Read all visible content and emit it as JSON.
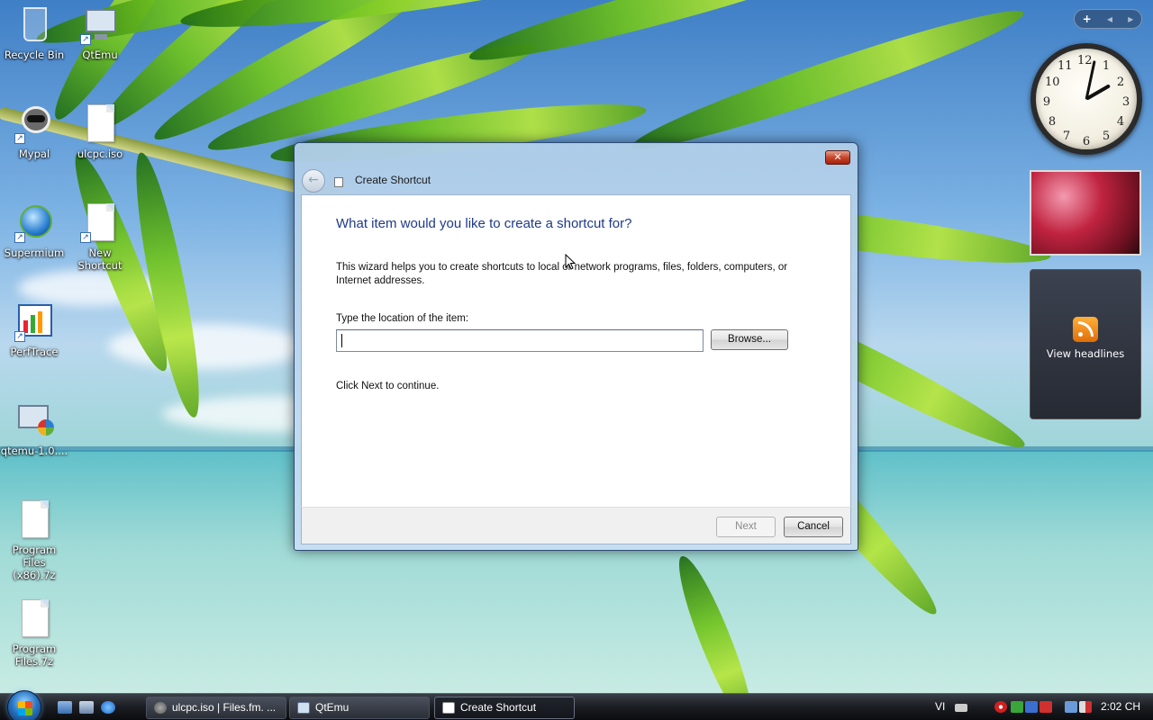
{
  "desktop": {
    "icons": [
      {
        "label": "Recycle Bin"
      },
      {
        "label": "QtEmu"
      },
      {
        "label": "Mypal"
      },
      {
        "label": "ulcpc.iso"
      },
      {
        "label": "Supermium"
      },
      {
        "label": "New Shortcut"
      },
      {
        "label": "PerfTrace"
      },
      {
        "label": "qtemu-1.0...."
      },
      {
        "label": "Program Files (x86).7z"
      },
      {
        "label": "Program Files.7z"
      }
    ]
  },
  "sidebar": {
    "add_label": "+",
    "clock": {
      "numbers": [
        "12",
        "1",
        "2",
        "3",
        "4",
        "5",
        "6",
        "7",
        "8",
        "9",
        "10",
        "11"
      ]
    },
    "feed": {
      "label": "View headlines"
    }
  },
  "dialog": {
    "title": "Create Shortcut",
    "close_label": "✕",
    "back_label": "←",
    "heading": "What item would you like to create a shortcut for?",
    "description": "This wizard helps you to create shortcuts to local or network programs, files, folders, computers, or Internet addresses.",
    "location_label": "Type the location of the item:",
    "location_value": "",
    "browse_label": "Browse...",
    "continue_text": "Click Next to continue.",
    "next_label": "Next",
    "cancel_label": "Cancel"
  },
  "taskbar": {
    "tasks": [
      {
        "label": "ulcpc.iso | Files.fm. ..."
      },
      {
        "label": "QtEmu"
      },
      {
        "label": "Create Shortcut"
      }
    ],
    "tray": {
      "language": "VI",
      "time": "2:02 CH"
    }
  }
}
